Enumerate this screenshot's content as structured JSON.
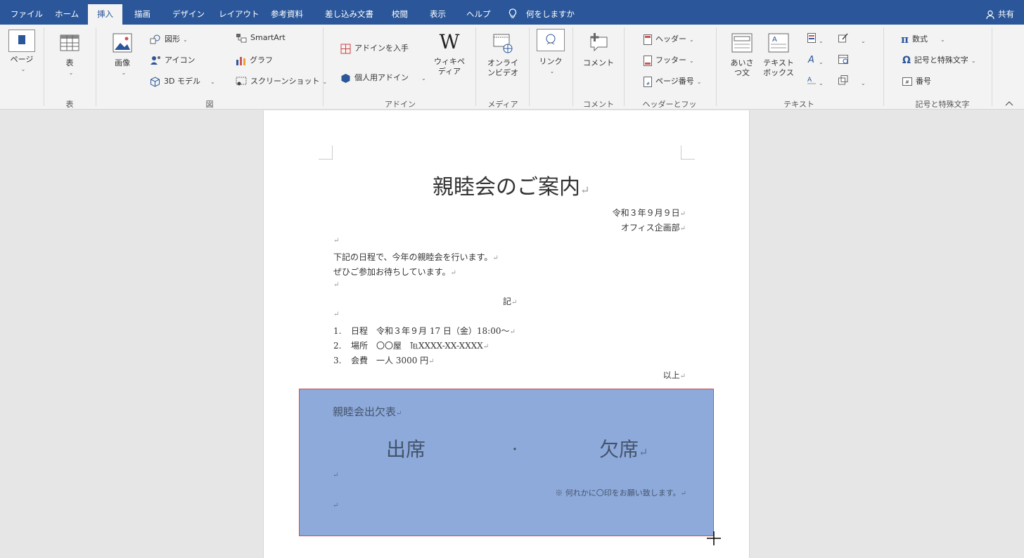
{
  "menu": {
    "tabs": [
      "ファイル",
      "ホーム",
      "挿入",
      "描画",
      "デザイン",
      "レイアウト",
      "参考資料",
      "差し込み文書",
      "校閲",
      "表示",
      "ヘルプ"
    ],
    "active_tab": "挿入",
    "help": "何をしますか",
    "share": "共有"
  },
  "ribbon": {
    "page": "ページ",
    "table": "表",
    "image": "画像",
    "shapes": "図形",
    "icons": "アイコン",
    "model3d": "3D モデル",
    "smartart": "SmartArt",
    "graph": "グラフ",
    "screenshot": "スクリーンショット",
    "get_addins": "アドインを入手",
    "my_addins": "個人用アドイン",
    "wikipedia": "ウィキペディア",
    "online_video": "オンラインビデオ",
    "link": "リンク",
    "comment": "コメント",
    "header": "ヘッダー",
    "footer": "フッター",
    "page_number": "ページ番号",
    "greeting": "あいさつ文",
    "textbox": "テキストボックス",
    "equation": "数式",
    "symbol": "記号と特殊文字",
    "number": "番号",
    "groups": {
      "table": "表",
      "illustrations": "図",
      "addins": "アドイン",
      "media": "メディア",
      "comments": "コメント",
      "header_footer": "ヘッダーとフッター",
      "text": "テキスト",
      "symbols": "記号と特殊文字"
    }
  },
  "document": {
    "title": "親睦会のご案内",
    "date": "令和３年９月９日",
    "sender": "オフィス企画部",
    "line1": "下記の日程で、今年の親睦会を行います。",
    "line2": "ぜひご参加お待ちしています。",
    "ki": "記",
    "items": [
      {
        "num": "1.",
        "text": "日程　令和３年９月 17 日（金）18:00～"
      },
      {
        "num": "2.",
        "text": "場所　〇〇屋　℡XXXX-XX-XXXX"
      },
      {
        "num": "3.",
        "text": "会費　一人 3000 円"
      }
    ],
    "ijo": "以上",
    "paragraph_mark": "↵"
  },
  "form": {
    "heading": "親睦会出欠表",
    "attend": "出席",
    "dot": "・",
    "absent": "欠席",
    "note": "※ 何れかに〇印をお願い致します。"
  },
  "colors": {
    "accent": "#2b579a",
    "ribbon_bg": "#f3f3f3",
    "shape_fill": "#8eaadb"
  }
}
